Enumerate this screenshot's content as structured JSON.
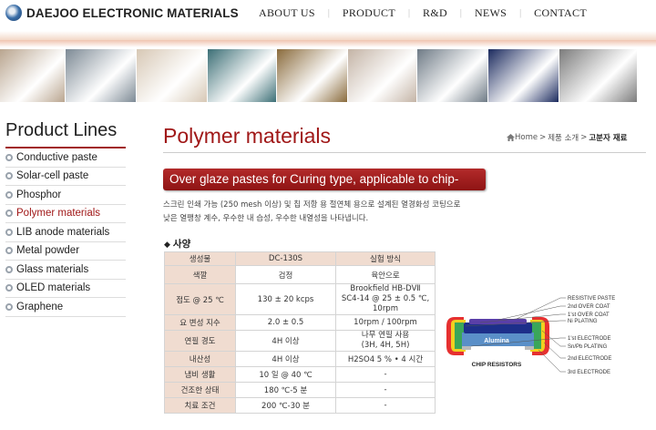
{
  "header": {
    "logo_text": "DAEJOO ELECTRONIC MATERIALS",
    "nav": [
      "ABOUT US",
      "PRODUCT",
      "R&D",
      "NEWS",
      "CONTACT"
    ],
    "nav_separator": "|"
  },
  "banner": {
    "tiles": [
      "#b9a58f",
      "#7d8a95",
      "#d7c8b5",
      "#3c6f76",
      "#8a6b3c",
      "#c4b4a6",
      "#6f7b86",
      "#1b2a5e",
      "#7c7c7c"
    ]
  },
  "sidebar": {
    "title": "Product Lines",
    "items": [
      {
        "label": "Conductive paste"
      },
      {
        "label": "Solar-cell paste"
      },
      {
        "label": "Phosphor"
      },
      {
        "label": "Polymer materials"
      },
      {
        "label": "LIB anode materials"
      },
      {
        "label": "Metal powder"
      },
      {
        "label": "Glass materials"
      },
      {
        "label": "OLED materials"
      },
      {
        "label": "Graphene"
      }
    ],
    "active": "Polymer materials"
  },
  "main": {
    "title": "Polymer materials",
    "breadcrumb": {
      "home": "Home",
      "sep": ">",
      "section": "제품 소개",
      "current": "고분자 재료"
    },
    "product_heading": "Over glaze pastes for Curing type, applicable to chip-resistor",
    "description": [
      "스크린 인쇄 가능 (250 mesh 이상) 및 칩 저항 용 절연체 용으로 설계된 열경화성 코팅으로",
      "낮은 열팽창 계수, 우수한 내 습성, 우수한 내열성을 나타냅니다."
    ],
    "spec_heading": "사양",
    "spec_marker": "◆",
    "table": {
      "headers": [
        "생성물",
        "DC-130S",
        "실험 방식"
      ],
      "rows": [
        {
          "key": "색깔",
          "value": "검정",
          "method": "육안으로"
        },
        {
          "key": "점도 @ 25 ℃",
          "value": "130 ± 20 kcps",
          "method": [
            "Brookfield HB-DVⅡ",
            "SC4-14 @ 25 ± 0.5 ℃,",
            "10rpm"
          ]
        },
        {
          "key": "요 변성 지수",
          "value": "2.0 ± 0.5",
          "method": "10rpm / 100rpm"
        },
        {
          "key": "연필 경도",
          "value": "4H 이상",
          "method": [
            "나무 연필 사용",
            "(3H, 4H, 5H)"
          ]
        },
        {
          "key": "내산성",
          "value": "4H 이상",
          "method": "H2SO4 5 % • 4 시간"
        },
        {
          "key": "냄비 생활",
          "value": "10 일 @ 40 ℃",
          "method": "-"
        },
        {
          "key": "건조한 상태",
          "value": "180 ℃-5 분",
          "method": "-"
        },
        {
          "key": "치료 조건",
          "value": "200 ℃-30 분",
          "method": "-"
        }
      ]
    },
    "diagram": {
      "labels": [
        "RESISTIVE PASTE",
        "2nd OVER COAT",
        "1'st OVER COAT",
        "Ni PLATING",
        "1'st ELECTRODE",
        "Sn/Pb PLATING",
        "2nd ELECTRODE",
        "3rd ELECTRODE"
      ],
      "substrate": "Alumina",
      "caption": "CHIP RESISTORS"
    }
  }
}
